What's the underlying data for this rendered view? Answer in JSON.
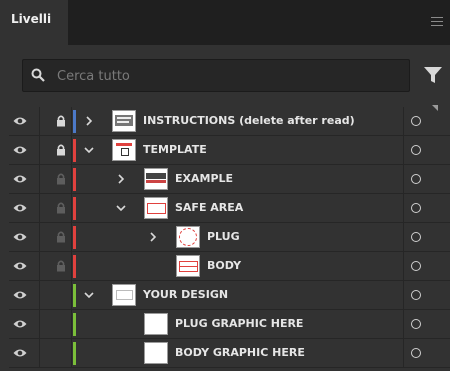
{
  "panel": {
    "tab_label": "Livelli",
    "search_placeholder": "Cerca tutto"
  },
  "colors": {
    "blue": "#4c79c8",
    "red": "#e0413e",
    "green": "#7bbf3a"
  },
  "layers": [
    {
      "name": "INSTRUCTIONS (delete after read)",
      "color": "blue",
      "indent": 0,
      "chevron": "right",
      "locked": true,
      "visible": true
    },
    {
      "name": "TEMPLATE",
      "color": "red",
      "indent": 0,
      "chevron": "down",
      "locked": true,
      "visible": true
    },
    {
      "name": "EXAMPLE",
      "color": "red",
      "indent": 1,
      "chevron": "right",
      "locked": true,
      "visible": true
    },
    {
      "name": "SAFE AREA",
      "color": "red",
      "indent": 1,
      "chevron": "down",
      "locked": true,
      "visible": true
    },
    {
      "name": "PLUG",
      "color": "red",
      "indent": 2,
      "chevron": "right",
      "locked": true,
      "visible": true
    },
    {
      "name": "BODY",
      "color": "red",
      "indent": 2,
      "chevron": "none",
      "locked": true,
      "visible": true
    },
    {
      "name": "YOUR DESIGN",
      "color": "green",
      "indent": 0,
      "chevron": "down",
      "locked": false,
      "visible": true
    },
    {
      "name": "PLUG GRAPHIC HERE",
      "color": "green",
      "indent": 1,
      "chevron": "none",
      "locked": false,
      "visible": true
    },
    {
      "name": "BODY GRAPHIC HERE",
      "color": "green",
      "indent": 1,
      "chevron": "none",
      "locked": false,
      "visible": true
    }
  ]
}
